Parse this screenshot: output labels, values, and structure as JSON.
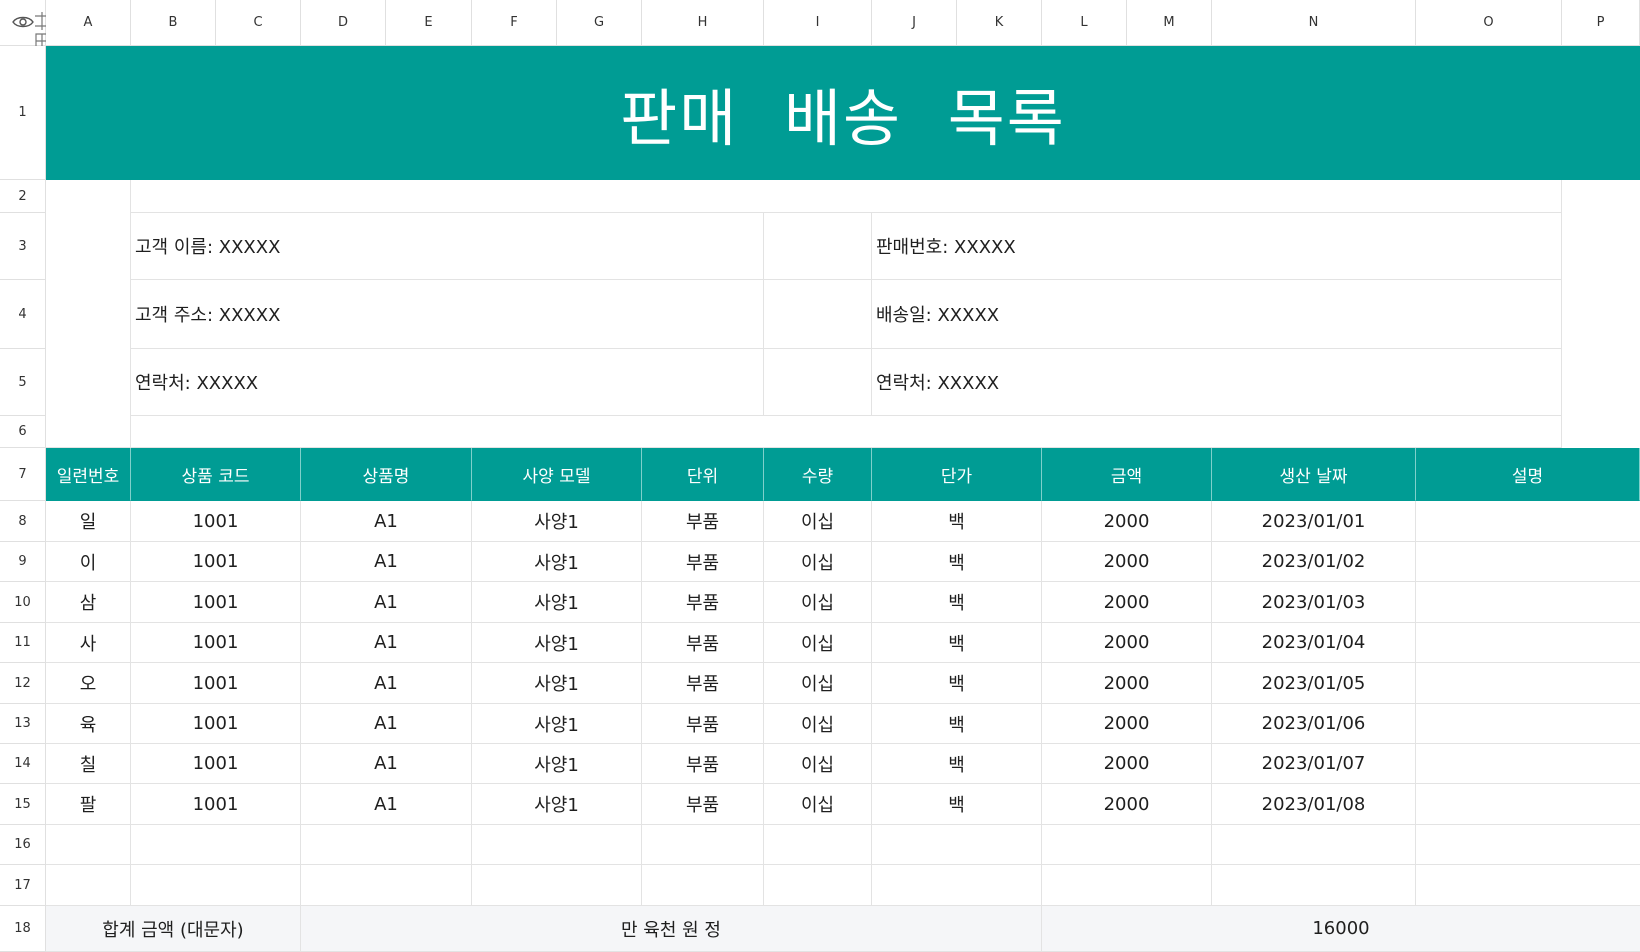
{
  "columns": [
    "A",
    "B",
    "C",
    "D",
    "E",
    "F",
    "G",
    "H",
    "I",
    "J",
    "K",
    "L",
    "M",
    "N",
    "O",
    "P"
  ],
  "rows": [
    "1",
    "2",
    "3",
    "4",
    "5",
    "6",
    "7",
    "8",
    "9",
    "10",
    "11",
    "12",
    "13",
    "14",
    "15",
    "16",
    "17",
    "18"
  ],
  "title": "판매 배송 목록",
  "info": {
    "customer_name": "고객 이름: XXXXX",
    "customer_address": "고객 주소: XXXXX",
    "customer_contact": "연락처: XXXXX",
    "sale_number": "판매번호: XXXXX",
    "ship_date": "배송일: XXXXX",
    "contact": "연락처: XXXXX"
  },
  "table": {
    "headers": [
      "일련번호",
      "상품 코드",
      "상품명",
      "사양 모델",
      "단위",
      "수량",
      "단가",
      "금액",
      "생산 날짜",
      "설명"
    ],
    "rows": [
      [
        "일",
        "1001",
        "A1",
        "사양1",
        "부품",
        "이십",
        "백",
        "2000",
        "2023/01/01",
        ""
      ],
      [
        "이",
        "1001",
        "A1",
        "사양1",
        "부품",
        "이십",
        "백",
        "2000",
        "2023/01/02",
        ""
      ],
      [
        "삼",
        "1001",
        "A1",
        "사양1",
        "부품",
        "이십",
        "백",
        "2000",
        "2023/01/03",
        ""
      ],
      [
        "사",
        "1001",
        "A1",
        "사양1",
        "부품",
        "이십",
        "백",
        "2000",
        "2023/01/04",
        ""
      ],
      [
        "오",
        "1001",
        "A1",
        "사양1",
        "부품",
        "이십",
        "백",
        "2000",
        "2023/01/05",
        ""
      ],
      [
        "육",
        "1001",
        "A1",
        "사양1",
        "부품",
        "이십",
        "백",
        "2000",
        "2023/01/06",
        ""
      ],
      [
        "칠",
        "1001",
        "A1",
        "사양1",
        "부품",
        "이십",
        "백",
        "2000",
        "2023/01/07",
        ""
      ],
      [
        "팔",
        "1001",
        "A1",
        "사양1",
        "부품",
        "이십",
        "백",
        "2000",
        "2023/01/08",
        ""
      ]
    ]
  },
  "total": {
    "label": "합계 금액 (대문자)",
    "amount_words": "만 육천 원 정",
    "amount": "16000"
  },
  "colors": {
    "accent": "#009c94",
    "total_bg": "#f5f6f8"
  },
  "icons": [
    "eye-icon",
    "freeze-icon"
  ]
}
